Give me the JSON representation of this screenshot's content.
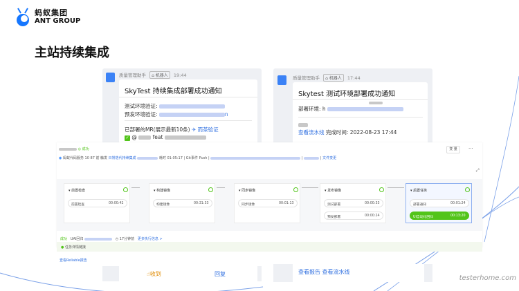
{
  "brand": {
    "name_cn": "蚂蚁集团",
    "name_en": "ANT GROUP"
  },
  "page_title": "主站持续集成",
  "chat_left": {
    "sender": "质量管理助手",
    "robot_tag": "机器人",
    "time": "19:44",
    "title": "SkyTest 持续集成部署成功通知",
    "test_env_label": "测试环境验证:",
    "pre_env_label": "预发环境验证:",
    "pre_env_suffix": "n",
    "mr_label": "已部署的MR(展示最新10条)",
    "mr_link": "而茶验证",
    "commit_text": "@",
    "commit_text2": "feat"
  },
  "chat_right": {
    "sender": "质量管理助手",
    "robot_tag": "机器人",
    "time": "17:44",
    "title": "Skytest 测试环境部署成功通知",
    "deploy_label": "部署环境: h",
    "pipeline_link": "查看流水线",
    "finish_time": "完成时间: 2022-08-23 17:44",
    "bottom_links": "查看报告 查看流水线"
  },
  "chat_bottom_left": {
    "collect": "收到",
    "reply": "回复"
  },
  "pipeline": {
    "status": "成功",
    "breadcrumb_prefix": "蚂蚁代码服务 10 87 前 触发",
    "pipeline_name": "日常迭代持续集成",
    "duration": "耗时 01:05:17",
    "trigger": "Git事件 Push",
    "file_changes": "文件变更",
    "btn_rerun": "变 量",
    "btn_more": "···",
    "stages": [
      {
        "name": "前置检查",
        "jobs": [
          {
            "name": "前置检查",
            "time": "00:00:42"
          }
        ]
      },
      {
        "name": "构建镜像",
        "jobs": [
          {
            "name": "构建镜像",
            "time": "00:31:33"
          }
        ]
      },
      {
        "name": "同步镜像",
        "jobs": [
          {
            "name": "同步镜像",
            "time": "00:01:13"
          }
        ]
      },
      {
        "name": "发布镜像",
        "jobs": [
          {
            "name": "测试部署",
            "time": "00:00:33"
          },
          {
            "name": "预发部署",
            "time": "00:00:24"
          }
        ]
      },
      {
        "name": "后置任务",
        "jobs": [
          {
            "name": "部署通知",
            "time": "00:01:24"
          },
          {
            "name": "UI自动化回归",
            "time": "00:13:20"
          }
        ]
      }
    ],
    "detail_status": "成功",
    "detail_name": "UAI回归",
    "detail_time": "17分钟前",
    "detail_link": "更多执行信息 >",
    "task_detail": "任务详情链接",
    "report_link": "查看Reliable报告"
  },
  "watermark": "testerhome.com",
  "colors": {
    "accent": "#2f6fe0",
    "success": "#52c41a",
    "brand_blue": "#1677ff"
  }
}
